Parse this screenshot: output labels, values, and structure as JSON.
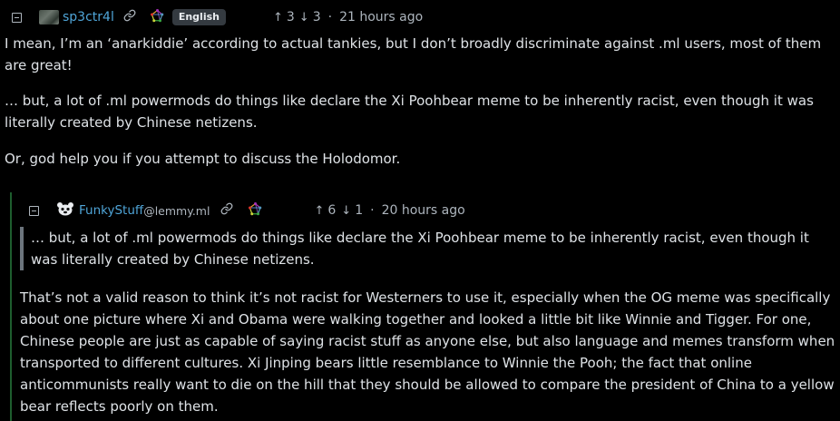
{
  "comments": [
    {
      "username": "sp3ctr4l",
      "instance": "",
      "language": "English",
      "upvotes": "3",
      "downvotes": "3",
      "time": "21 hours ago",
      "paragraphs": [
        "I mean, I’m an ‘anarkiddie’ according to actual tankies, but I don’t broadly discriminate against .ml users, most of them are great!",
        "… but, a lot of .ml powermods do things like declare the Xi Poohbear meme to be inherently racist, even though it was literally created by Chinese netizens.",
        "Or, god help you if you attempt to discuss the Holodomor."
      ]
    },
    {
      "username": "FunkyStuff",
      "instance": "@lemmy.ml",
      "upvotes": "6",
      "downvotes": "1",
      "time": "20 hours ago",
      "quote": "… but, a lot of .ml powermods do things like declare the Xi Poohbear meme to be inherently racist, even though it was literally created by Chinese netizens.",
      "paragraphs": [
        "That’s not a valid reason to think it’s not racist for Westerners to use it, especially when the OG meme was specifically about one picture where Xi and Obama were walking together and looked a little bit like Winnie and Tigger. For one, Chinese people are just as capable of saying racist stuff as anyone else, but also language and memes transform when transported to different cultures. Xi Jinping bears little resemblance to Winnie the Pooh; the fact that online anticommunists really want to die on the hill that they should be allowed to compare the president of China to a yellow bear reflects poorly on them."
      ]
    }
  ],
  "symbols": {
    "up_arrow": "↑",
    "down_arrow": "↓",
    "dot": "·"
  },
  "colors": {
    "background": "#000000",
    "text": "#dee2e6",
    "username": "#4fa5d8",
    "muted": "#adb5bd",
    "badge_bg": "#343a40",
    "thread_line": "#1e5e2e",
    "quote_bar": "#6c757d"
  },
  "icons": {
    "collapse": "minus-square-icon",
    "link": "link-icon",
    "federation": "fediverse-icon"
  }
}
